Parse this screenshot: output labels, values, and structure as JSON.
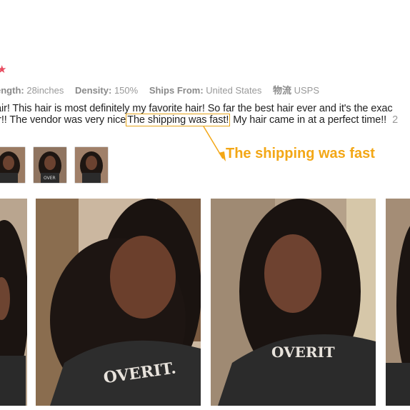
{
  "rating": {
    "star_icon": "star-icon",
    "star_color": "#e84a5f"
  },
  "attributes": [
    {
      "key": "ength:",
      "value": "28inches"
    },
    {
      "key": "Density:",
      "value": "150%"
    },
    {
      "key": "Ships From:",
      "value": "United States"
    },
    {
      "key": "物流",
      "value": "USPS"
    }
  ],
  "review": {
    "line1": "air! This hair is most definitely my favorite hair!  So far the best hair ever and it's the exac",
    "line2_before": "ir!! The vendor was very nice",
    "line2_highlight": "The shipping was fast!",
    "line2_after": " My hair came in at a perfect time!!",
    "line2_more": "2"
  },
  "callout": {
    "text": "The shipping was fast",
    "color": "#f3a716"
  },
  "thumbnails": [
    "thumb-1",
    "thumb-2",
    "thumb-3"
  ],
  "photos": [
    {
      "shirt_text": ""
    },
    {
      "shirt_text": "OVERIT."
    },
    {
      "shirt_text": "OVERIT"
    },
    {
      "shirt_text": ""
    }
  ]
}
